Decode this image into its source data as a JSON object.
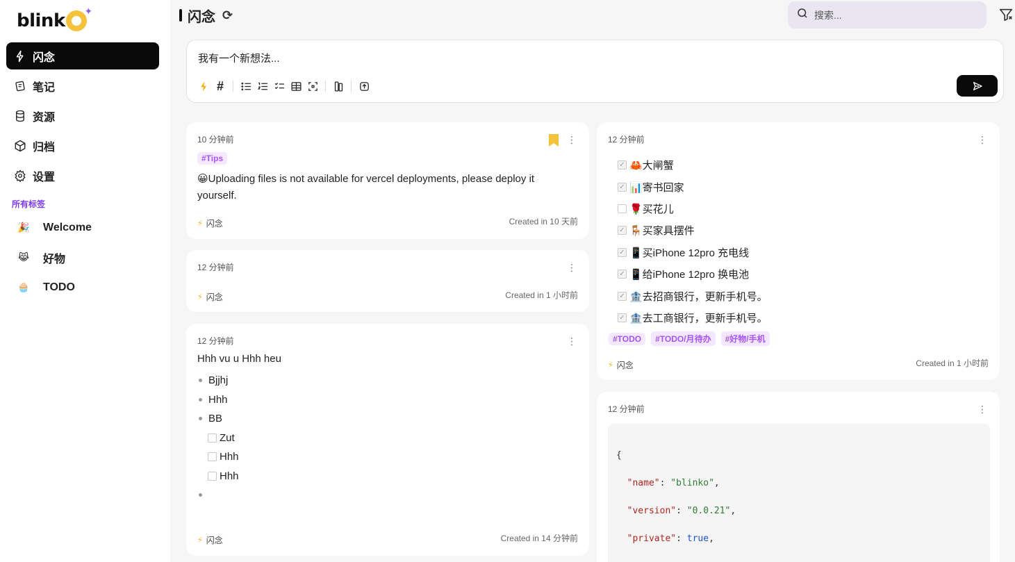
{
  "sidebar": {
    "logo": "blinko",
    "nav": [
      {
        "label": "闪念",
        "icon": "flash-icon",
        "active": true
      },
      {
        "label": "笔记",
        "icon": "notes-icon",
        "active": false
      },
      {
        "label": "资源",
        "icon": "database-icon",
        "active": false
      },
      {
        "label": "归档",
        "icon": "archive-box-icon",
        "active": false
      },
      {
        "label": "设置",
        "icon": "gear-icon",
        "active": false
      }
    ],
    "tags_title": "所有标签",
    "tags": [
      {
        "emoji": "🎉",
        "label": "Welcome"
      },
      {
        "emoji": "😹",
        "label": "好物"
      },
      {
        "emoji": "🧁",
        "label": "TODO"
      }
    ]
  },
  "header": {
    "title": "闪念",
    "search_placeholder": "搜索..."
  },
  "editor": {
    "placeholder_text": "我有一个新想法..."
  },
  "cards": {
    "c1": {
      "time": "10 分钟前",
      "tag": "#Tips",
      "content": "😀Uploading files is not available for vercel deployments, please deploy it yourself.",
      "footer_tag": "闪念",
      "created": "Created in 10 天前",
      "bookmark_color": "#f5c33b"
    },
    "c2": {
      "time": "12 分钟前",
      "footer_tag": "闪念",
      "created": "Created in 1 小时前"
    },
    "c3": {
      "time": "12 分钟前",
      "heading": "Hhh vu u Hhh heu",
      "bullets": [
        "Bjjhj",
        "Hhh",
        "BB"
      ],
      "subtodos": [
        "Zut",
        "Hhh",
        "Hhh"
      ],
      "footer_tag": "闪念",
      "created": "Created in 14 分钟前"
    },
    "c4": {
      "time": "12 分钟前",
      "todos": [
        {
          "text": "🦀大闸蟹",
          "checked": true
        },
        {
          "text": "📊寄书回家",
          "checked": true
        },
        {
          "text": "🌹买花儿",
          "checked": false
        },
        {
          "text": "🪑买家具摆件",
          "checked": true
        },
        {
          "text": "📱买iPhone 12pro 充电线",
          "checked": true
        },
        {
          "text": "📱给iPhone 12pro 换电池",
          "checked": true
        },
        {
          "text": "🏦去招商银行，更新手机号。",
          "checked": true
        },
        {
          "text": "🏦去工商银行，更新手机号。",
          "checked": true
        }
      ],
      "tags": [
        "#TODO",
        "#TODO/月待办",
        "#好物/手机"
      ],
      "footer_tag": "闪念",
      "created": "Created in 1 小时前"
    },
    "c5": {
      "time": "12 分钟前",
      "code": {
        "open": "{",
        "name_key": "\"name\"",
        "name_val": "\"blinko\"",
        "version_key": "\"version\"",
        "version_val": "\"0.0.21\"",
        "private_key": "\"private\"",
        "private_val": "true"
      }
    }
  }
}
